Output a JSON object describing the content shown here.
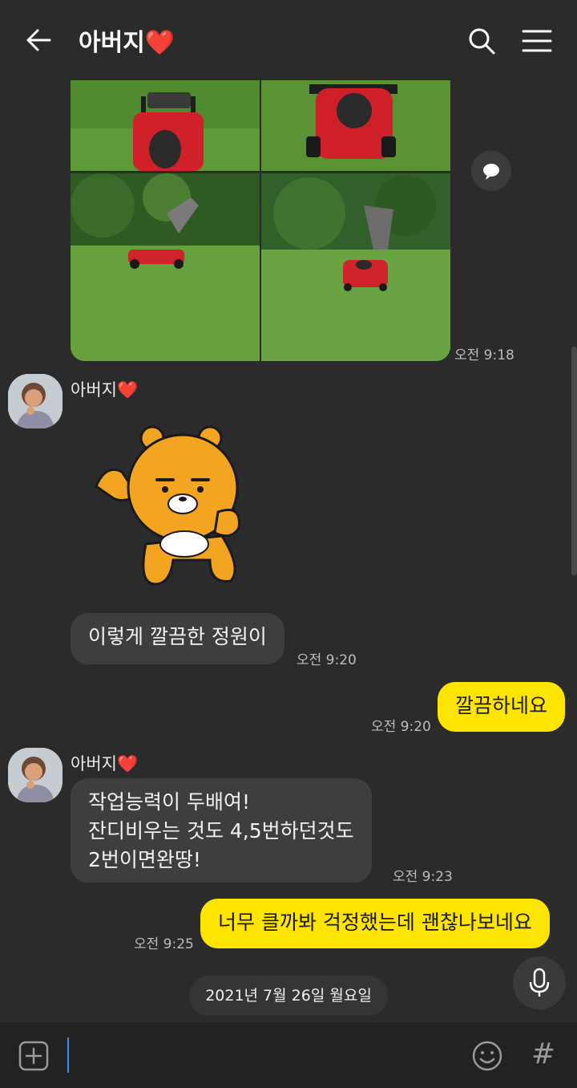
{
  "header": {
    "title": "아버지",
    "title_heart": "❤️",
    "back_icon": "arrow-left-icon",
    "search_icon": "search-icon",
    "menu_icon": "hamburger-menu-icon"
  },
  "messages": {
    "photo_time": "오전 9:18",
    "sender_name": "아버지",
    "sender_heart": "❤️",
    "msg1_text": "이렇게 깔끔한 정원이",
    "msg1_time": "오전 9:20",
    "reply1_text": "깔끔하네요",
    "reply1_time": "오전 9:20",
    "msg2_lines": [
      "작업능력이 두배여!",
      "잔디비우는 것도 4,5번하던것도",
      "2번이면완땅!"
    ],
    "msg2_time": "오전 9:23",
    "reply2_text": "너무 클까봐 걱정했는데 괜찮나보네요",
    "reply2_time": "오전 9:25",
    "date_divider": "2021년 7월 26일 월요일"
  },
  "input_bar": {
    "value": "",
    "hash_label": "#",
    "plus_icon": "plus-square-icon",
    "emoji_icon": "smiley-icon",
    "mic_icon": "microphone-icon"
  },
  "colors": {
    "background": "#2b2b2b",
    "incoming_bubble": "#3e3e3e",
    "outgoing_bubble": "#fee500",
    "heart": "#e8242b"
  }
}
